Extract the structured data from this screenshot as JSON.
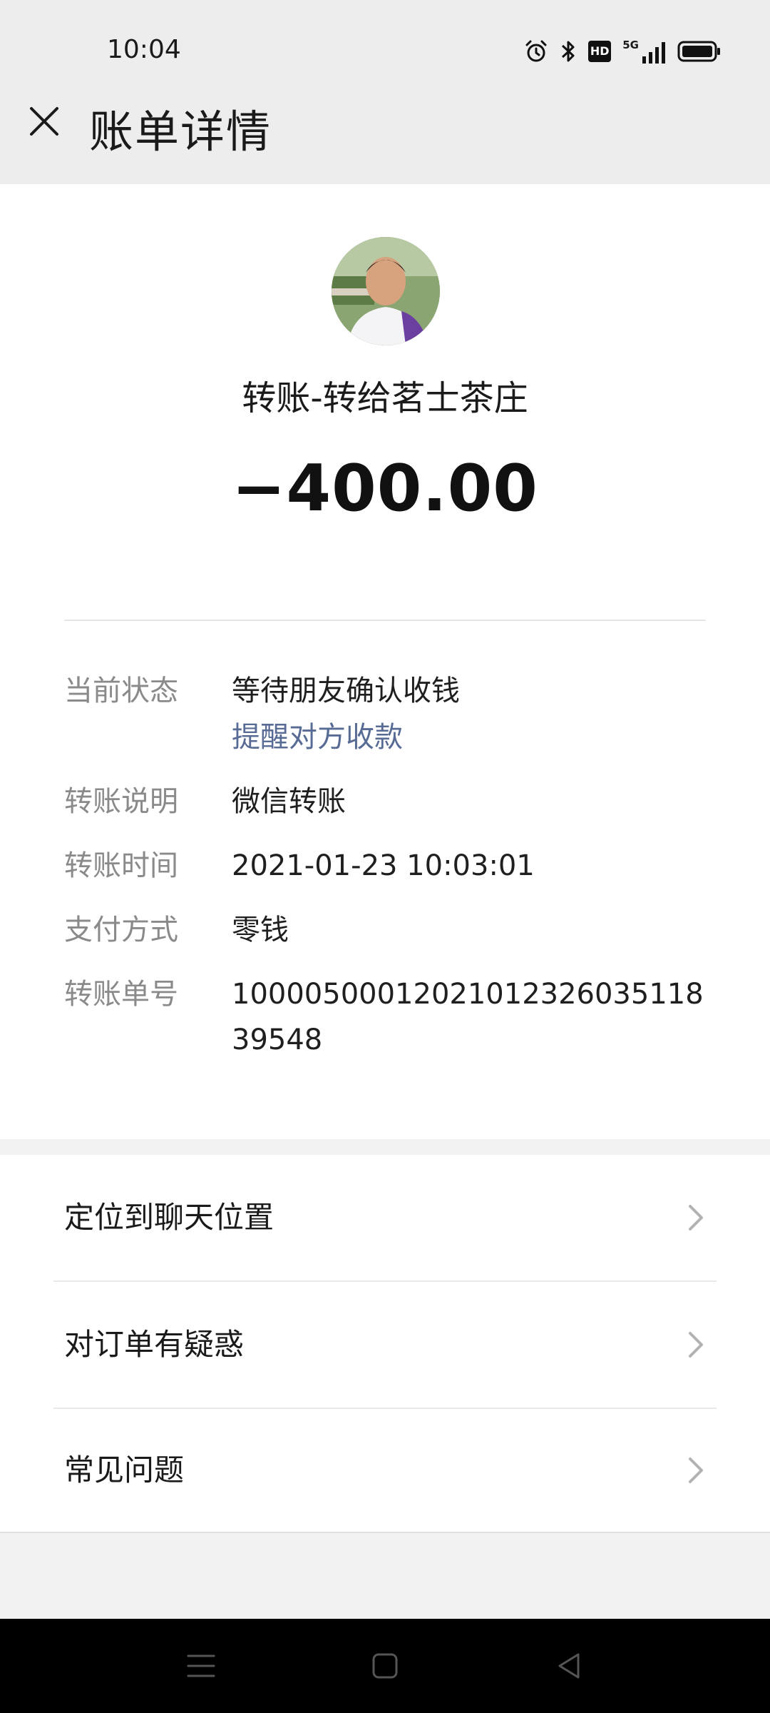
{
  "status_bar": {
    "time": "10:04",
    "network_label": "5G",
    "hd_label": "HD",
    "icons": [
      "alarm-icon",
      "bluetooth-icon",
      "hd-icon",
      "signal-5g-icon",
      "battery-icon"
    ]
  },
  "header": {
    "title": "账单详情",
    "close_icon": "close-icon"
  },
  "transaction": {
    "title": "转账-转给茗士茶庄",
    "amount": "−400.00"
  },
  "details": {
    "status_label": "当前状态",
    "status_value": "等待朋友确认收钱",
    "remind_link": "提醒对方收款",
    "note_label": "转账说明",
    "note_value": "微信转账",
    "time_label": "转账时间",
    "time_value": "2021-01-23 10:03:01",
    "payment_label": "支付方式",
    "payment_value": "零钱",
    "order_label": "转账单号",
    "order_value": "1000050001202101232603511839548"
  },
  "actions": [
    {
      "label": "定位到聊天位置"
    },
    {
      "label": "对订单有疑惑"
    },
    {
      "label": "常见问题"
    }
  ],
  "nav_bar": {
    "icons": [
      "menu-icon",
      "home-icon",
      "back-icon"
    ]
  },
  "colors": {
    "link": "#576b95",
    "label_gray": "#8a8a8a",
    "background": "#f2f2f2",
    "header_bg": "#ededed"
  }
}
